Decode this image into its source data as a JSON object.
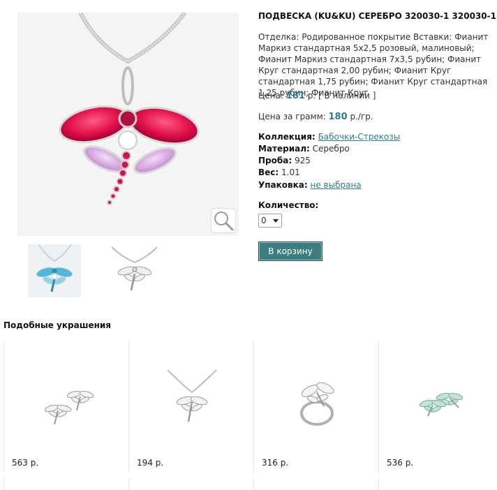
{
  "product": {
    "title": "ПОДВЕСКА (KU&KU) СЕРЕБРО 320030-1 320030-1",
    "description": "Отделка: Родированное покрытие Вставки: Фианит Маркиз стандартная 5x2,5 розовый, малиновый; Фианит Маркиз стандартная 7x3,5 рубин; Фианит Круг стандартная 2,00 рубин; Фианит Круг стандартная 1,75 рубин; Фианит Круг стандартная 1,25 рубин; Фианит Круг",
    "price_label": "Цена:",
    "price_value": "181",
    "price_suffix": "р. [ В наличии ]",
    "gram_price_label": "Цена за грамм:",
    "gram_price_value": "180",
    "gram_price_suffix": "р./гр.",
    "collection_label": "Коллекция:",
    "collection_value": "Бабочки-Стрекозы",
    "material_label": "Материал:",
    "material_value": "Серебро",
    "probe_label": "Проба:",
    "probe_value": "925",
    "weight_label": "Вес:",
    "weight_value": "1.01",
    "packaging_label": "Упаковка:",
    "packaging_value": "не выбрана",
    "quantity_label": "Количество:",
    "quantity_value": "0",
    "cart_button": "В корзину"
  },
  "similar": {
    "heading": "Подобные украшения",
    "items": [
      {
        "price": "563 р."
      },
      {
        "price": "194 р."
      },
      {
        "price": "316 р."
      },
      {
        "price": "536 р."
      }
    ]
  },
  "colors": {
    "accent": "#2f7f87",
    "button": "#3d7d80",
    "ruby": "#e0104a",
    "lilac": "#d8a6e0",
    "aqua": "#4fb7d8"
  }
}
